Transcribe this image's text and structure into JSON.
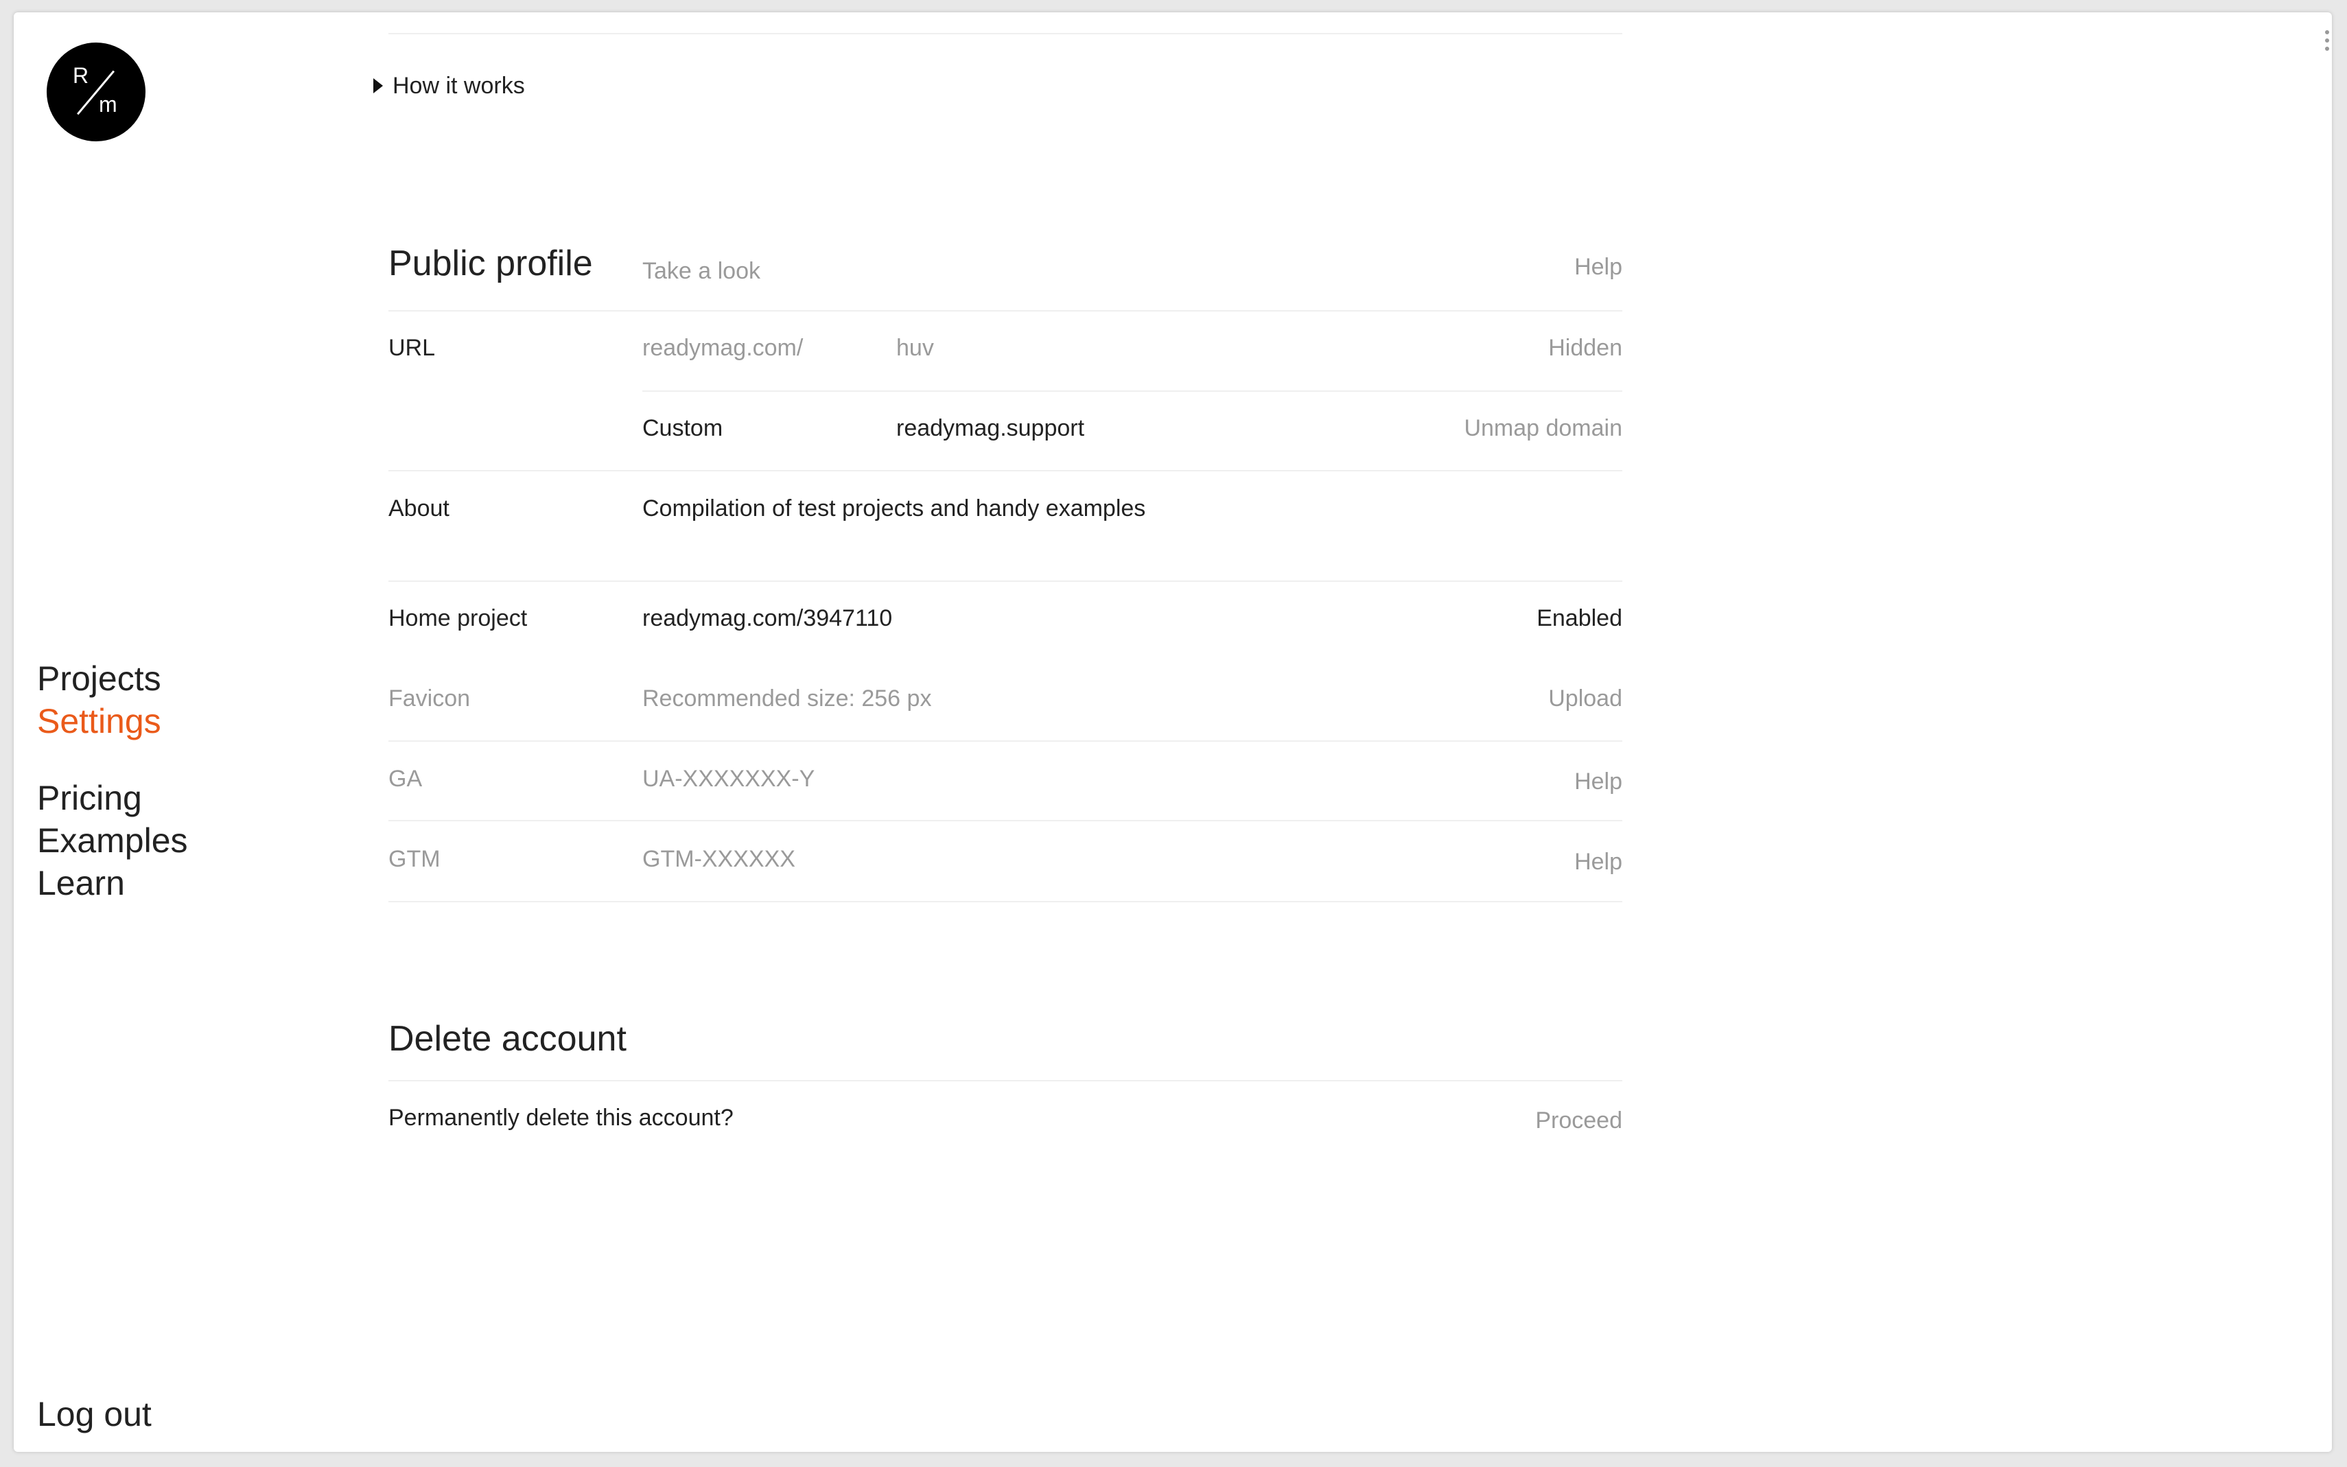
{
  "logo": {
    "letter_top": "R",
    "letter_bottom": "m"
  },
  "nav": {
    "top": [
      {
        "label": "Projects",
        "active": false
      },
      {
        "label": "Settings",
        "active": true
      }
    ],
    "middle": [
      "Pricing",
      "Examples",
      "Learn"
    ],
    "logout": "Log out"
  },
  "how_it_works": "How it works",
  "public_profile": {
    "title": "Public profile",
    "take_a_look": "Take a look",
    "help": "Help",
    "url": {
      "label": "URL",
      "domain_prefix": "readymag.com/",
      "value": "huv",
      "status": "Hidden"
    },
    "custom": {
      "label": "Custom",
      "value": "readymag.support",
      "action": "Unmap domain"
    },
    "about": {
      "label": "About",
      "value": "Compilation of test projects and handy examples"
    },
    "home_project": {
      "label": "Home project",
      "value": "readymag.com/3947110",
      "status": "Enabled"
    },
    "favicon": {
      "label": "Favicon",
      "hint": "Recommended size: 256 px",
      "action": "Upload"
    },
    "ga": {
      "label": "GA",
      "placeholder": "UA-XXXXXXX-Y",
      "action": "Help"
    },
    "gtm": {
      "label": "GTM",
      "placeholder": "GTM-XXXXXX",
      "action": "Help"
    }
  },
  "delete_account": {
    "title": "Delete account",
    "question": "Permanently delete this account?",
    "action": "Proceed"
  },
  "colors": {
    "accent": "#ea5a1a",
    "muted": "#9a9a9a",
    "text": "#222222"
  }
}
